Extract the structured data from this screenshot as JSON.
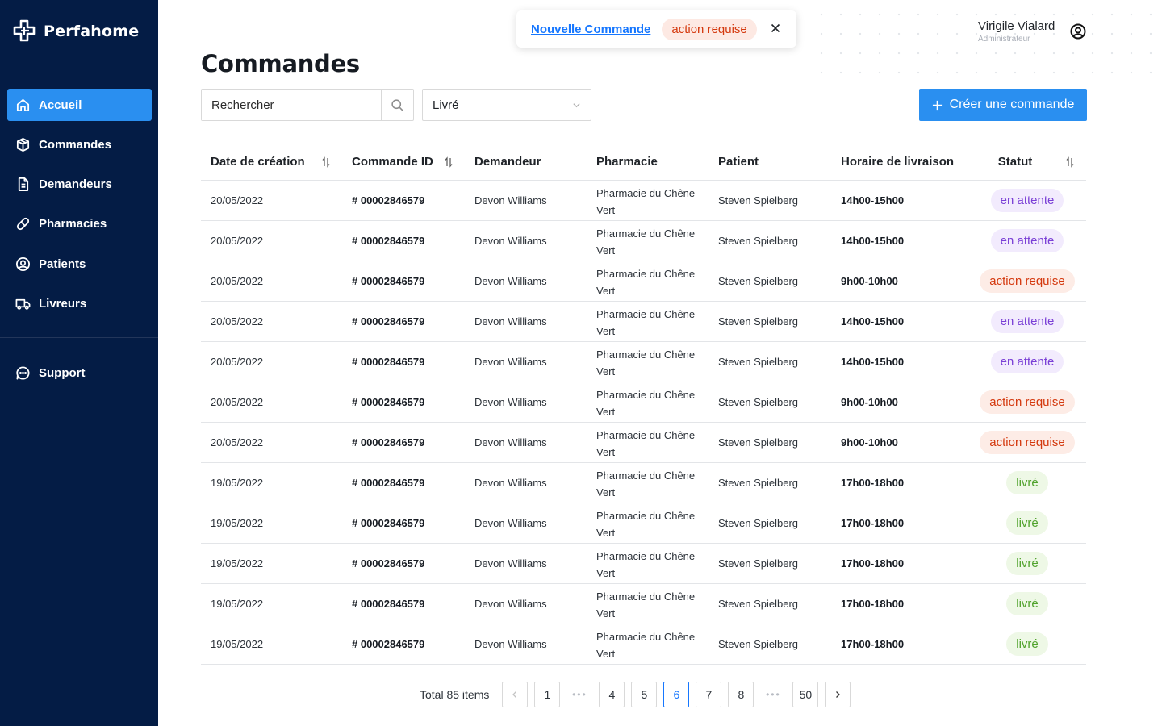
{
  "brand": {
    "name": "Perfahome"
  },
  "sidebar": {
    "items": [
      {
        "label": "Accueil",
        "icon": "home-icon",
        "active": true
      },
      {
        "label": "Commandes",
        "icon": "box-icon"
      },
      {
        "label": "Demandeurs",
        "icon": "document-icon"
      },
      {
        "label": "Pharmacies",
        "icon": "pill-icon"
      },
      {
        "label": "Patients",
        "icon": "user-circle-icon"
      },
      {
        "label": "Livreurs",
        "icon": "truck-icon"
      }
    ],
    "support": {
      "label": "Support",
      "icon": "chat-icon"
    }
  },
  "notification": {
    "link": "Nouvelle Commande",
    "badge": "action requise",
    "badge_color": "#d4380d"
  },
  "user": {
    "name": "Virigile Vialard",
    "role": "Administrateur"
  },
  "page": {
    "title": "Commandes"
  },
  "filters": {
    "search_placeholder": "Rechercher",
    "status_value": "Livré",
    "create_label": "Créer une commande"
  },
  "table": {
    "columns": [
      "Date de création",
      "Commande ID",
      "Demandeur",
      "Pharmacie",
      "Patient",
      "Horaire de livraison",
      "Statut"
    ],
    "rows": [
      {
        "date": "20/05/2022",
        "id": "# 00002846579",
        "demandeur": "Devon Williams",
        "pharmacie_l1": "Pharmacie du Chêne",
        "pharmacie_l2": "Vert",
        "patient": "Steven Spielberg",
        "horaire": "14h00-15h00",
        "statut": "en attente",
        "statut_type": "attente"
      },
      {
        "date": "20/05/2022",
        "id": "# 00002846579",
        "demandeur": "Devon Williams",
        "pharmacie_l1": "Pharmacie du Chêne",
        "pharmacie_l2": "Vert",
        "patient": "Steven Spielberg",
        "horaire": "14h00-15h00",
        "statut": "en attente",
        "statut_type": "attente"
      },
      {
        "date": "20/05/2022",
        "id": "# 00002846579",
        "demandeur": "Devon Williams",
        "pharmacie_l1": "Pharmacie du Chêne",
        "pharmacie_l2": "Vert",
        "patient": "Steven Spielberg",
        "horaire": "9h00-10h00",
        "statut": "action requise",
        "statut_type": "action"
      },
      {
        "date": "20/05/2022",
        "id": "# 00002846579",
        "demandeur": "Devon Williams",
        "pharmacie_l1": "Pharmacie du Chêne",
        "pharmacie_l2": "Vert",
        "patient": "Steven Spielberg",
        "horaire": "14h00-15h00",
        "statut": "en attente",
        "statut_type": "attente"
      },
      {
        "date": "20/05/2022",
        "id": "# 00002846579",
        "demandeur": "Devon Williams",
        "pharmacie_l1": "Pharmacie du Chêne",
        "pharmacie_l2": "Vert",
        "patient": "Steven Spielberg",
        "horaire": "14h00-15h00",
        "statut": "en attente",
        "statut_type": "attente"
      },
      {
        "date": "20/05/2022",
        "id": "# 00002846579",
        "demandeur": "Devon Williams",
        "pharmacie_l1": "Pharmacie du Chêne",
        "pharmacie_l2": "Vert",
        "patient": "Steven Spielberg",
        "horaire": "9h00-10h00",
        "statut": "action requise",
        "statut_type": "action"
      },
      {
        "date": "20/05/2022",
        "id": "# 00002846579",
        "demandeur": "Devon Williams",
        "pharmacie_l1": "Pharmacie du Chêne",
        "pharmacie_l2": "Vert",
        "patient": "Steven Spielberg",
        "horaire": "9h00-10h00",
        "statut": "action requise",
        "statut_type": "action"
      },
      {
        "date": "19/05/2022",
        "id": "# 00002846579",
        "demandeur": "Devon Williams",
        "pharmacie_l1": "Pharmacie du Chêne",
        "pharmacie_l2": "Vert",
        "patient": "Steven Spielberg",
        "horaire": "17h00-18h00",
        "statut": "livré",
        "statut_type": "livre"
      },
      {
        "date": "19/05/2022",
        "id": "# 00002846579",
        "demandeur": "Devon Williams",
        "pharmacie_l1": "Pharmacie du Chêne",
        "pharmacie_l2": "Vert",
        "patient": "Steven Spielberg",
        "horaire": "17h00-18h00",
        "statut": "livré",
        "statut_type": "livre"
      },
      {
        "date": "19/05/2022",
        "id": "# 00002846579",
        "demandeur": "Devon Williams",
        "pharmacie_l1": "Pharmacie du Chêne",
        "pharmacie_l2": "Vert",
        "patient": "Steven Spielberg",
        "horaire": "17h00-18h00",
        "statut": "livré",
        "statut_type": "livre"
      },
      {
        "date": "19/05/2022",
        "id": "# 00002846579",
        "demandeur": "Devon Williams",
        "pharmacie_l1": "Pharmacie du Chêne",
        "pharmacie_l2": "Vert",
        "patient": "Steven Spielberg",
        "horaire": "17h00-18h00",
        "statut": "livré",
        "statut_type": "livre"
      },
      {
        "date": "19/05/2022",
        "id": "# 00002846579",
        "demandeur": "Devon Williams",
        "pharmacie_l1": "Pharmacie du Chêne",
        "pharmacie_l2": "Vert",
        "patient": "Steven Spielberg",
        "horaire": "17h00-18h00",
        "statut": "livré",
        "statut_type": "livre"
      }
    ]
  },
  "pagination": {
    "total": "Total 85 items",
    "pages": [
      "1",
      "...",
      "4",
      "5",
      "6",
      "7",
      "8",
      "...",
      "50"
    ],
    "current": "6"
  },
  "colors": {
    "sidebar_bg": "#041c45",
    "accent": "#2a8ff0",
    "link": "#1677ff"
  }
}
